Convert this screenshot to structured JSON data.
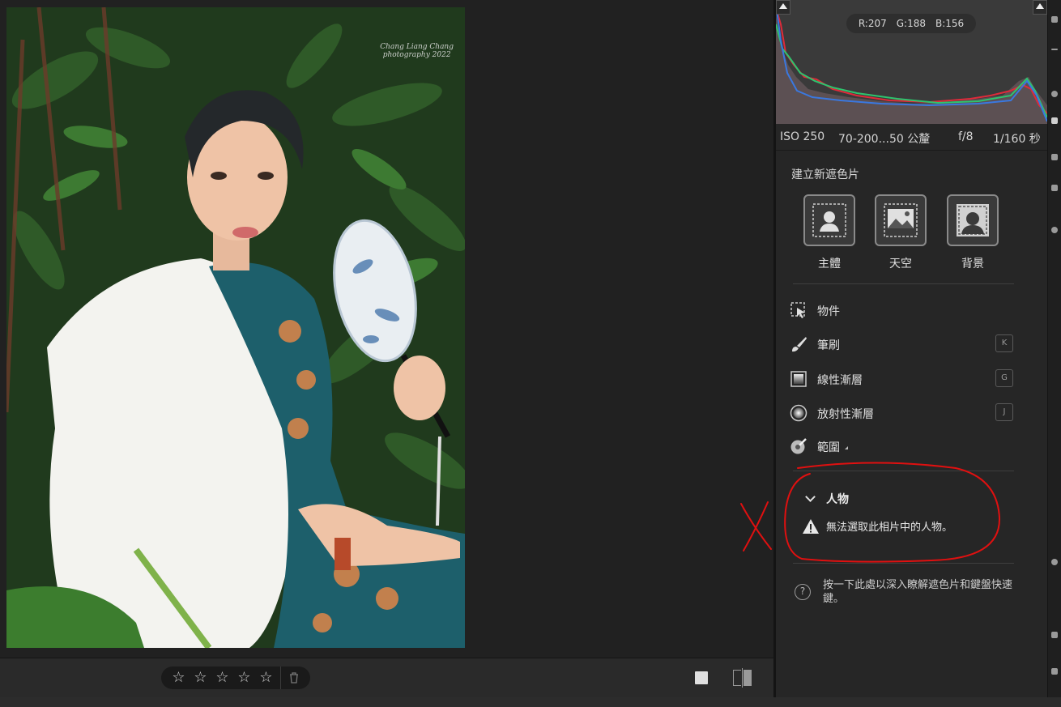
{
  "photo": {
    "watermark_line1": "Chang Liang Chang",
    "watermark_line2": "photography 2022"
  },
  "bottombar": {
    "stars": [
      "☆",
      "☆",
      "☆",
      "☆",
      "☆"
    ],
    "trash_icon": "trash-icon"
  },
  "histogram": {
    "rgb_r": "R:207",
    "rgb_g": "G:188",
    "rgb_b": "B:156"
  },
  "exif": {
    "iso": "ISO 250",
    "lens": "70-200...50 公釐",
    "aperture": "f/8",
    "shutter": "1/160 秒"
  },
  "masking": {
    "title": "建立新遮色片",
    "buttons": [
      {
        "label": "主體",
        "icon": "subject-icon"
      },
      {
        "label": "天空",
        "icon": "sky-icon"
      },
      {
        "label": "背景",
        "icon": "background-icon"
      }
    ],
    "tools": [
      {
        "label": "物件",
        "key": "",
        "icon": "object-select-icon"
      },
      {
        "label": "筆刷",
        "key": "K",
        "icon": "brush-icon"
      },
      {
        "label": "線性漸層",
        "key": "G",
        "icon": "linear-gradient-icon"
      },
      {
        "label": "放射性漸層",
        "key": "J",
        "icon": "radial-gradient-icon"
      },
      {
        "label": "範圍",
        "key": "",
        "icon": "range-icon"
      }
    ],
    "people": {
      "heading": "人物",
      "warning": "無法選取此相片中的人物。"
    },
    "help": "按一下此處以深入瞭解遮色片和鍵盤快速鍵。"
  },
  "colors": {
    "annotation_red": "#e01010",
    "panel_bg": "#262626"
  }
}
